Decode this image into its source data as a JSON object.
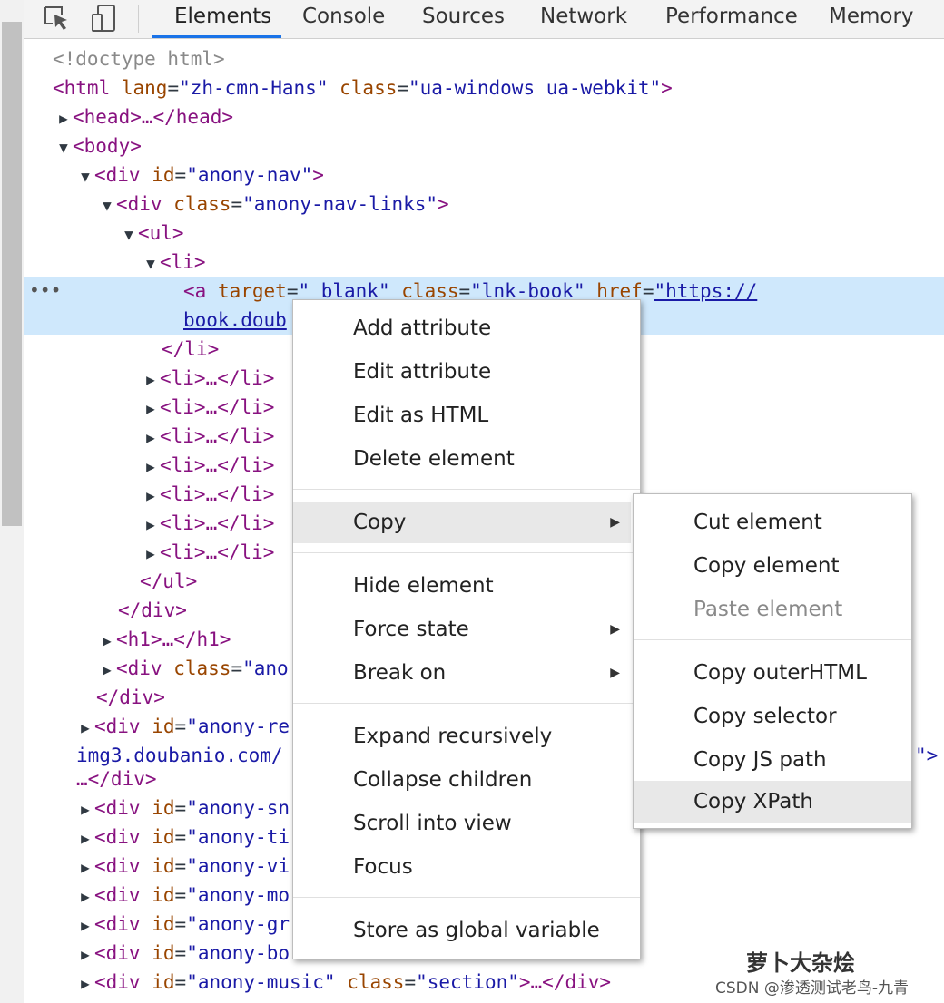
{
  "toolbar": {
    "tabs": [
      {
        "label": "Elements"
      },
      {
        "label": "Console"
      },
      {
        "label": "Sources"
      },
      {
        "label": "Network"
      },
      {
        "label": "Performance"
      },
      {
        "label": "Memory"
      }
    ],
    "active_tab": "Elements",
    "icons": [
      "inspect-element-icon",
      "device-toolbar-icon"
    ]
  },
  "tree": {
    "doctype": "<!doctype html>",
    "html_tag": "<html",
    "html_lang_attr": "lang",
    "html_lang_val": "\"zh-cmn-Hans\"",
    "html_class_attr": "class",
    "html_class_val": "\"ua-windows ua-webkit\"",
    "head": "<head>…</head>",
    "body": "<body>",
    "div_open": "<div",
    "id_attr": "id",
    "class_attr": "class",
    "anony_nav_val": "\"anony-nav\"",
    "nav_links_val": "\"anony-nav-links\"",
    "ul_open": "<ul>",
    "li_open": "<li>",
    "a_open": "<a",
    "target_attr": "target",
    "target_val": "\"_blank\"",
    "lnk_class_val": "\"lnk-book\"",
    "href_attr": "href",
    "href_val_1": "\"https://",
    "href_val_2": "book.doub",
    "li_close": "</li>",
    "li_collapsed": "<li>…</li>",
    "ul_close": "</ul>",
    "div_close": "</div>",
    "h1_collapsed": "<h1>…</h1>",
    "anon_val": "\"ano",
    "anony_re_val": "\"anony-re",
    "img_line": "img3.doubanio.com/",
    "img_tail": "\">",
    "ellipsis_div_close": "…</div>",
    "anony_sns": "\"anony-sn",
    "anony_time": "\"anony-ti",
    "anony_video": "\"anony-vi",
    "anony_movie": "\"anony-mo",
    "anony_group": "\"anony-gr",
    "anony_book": "\"anony-bo",
    "anony_music_val": "\"anony-music\"",
    "section_val": "\"section\"",
    "collapsed_tail": ">…</div>",
    "eq": "=",
    "gt": ">",
    "dots": "•••"
  },
  "context_menu": {
    "items": [
      {
        "label": "Add attribute"
      },
      {
        "label": "Edit attribute"
      },
      {
        "label": "Edit as HTML"
      },
      {
        "label": "Delete element"
      },
      {
        "label": "Copy",
        "submenu": true,
        "highlighted": true
      },
      {
        "label": "Hide element"
      },
      {
        "label": "Force state",
        "submenu": true
      },
      {
        "label": "Break on",
        "submenu": true
      },
      {
        "label": "Expand recursively"
      },
      {
        "label": "Collapse children"
      },
      {
        "label": "Scroll into view"
      },
      {
        "label": "Focus"
      },
      {
        "label": "Store as global variable"
      }
    ]
  },
  "copy_submenu": {
    "items": [
      {
        "label": "Cut element"
      },
      {
        "label": "Copy element"
      },
      {
        "label": "Paste element",
        "disabled": true
      },
      {
        "label": "Copy outerHTML"
      },
      {
        "label": "Copy selector"
      },
      {
        "label": "Copy JS path"
      },
      {
        "label": "Copy XPath",
        "highlighted": true
      }
    ]
  },
  "watermark": {
    "line1": "萝卜大杂烩",
    "line2": "CSDN @渗透测试老鸟-九青"
  },
  "colors": {
    "tag": "#881280",
    "attr": "#994500",
    "value": "#1a1aa6",
    "selection": "#cfe8fc",
    "tab_underline": "#1a73e8"
  }
}
